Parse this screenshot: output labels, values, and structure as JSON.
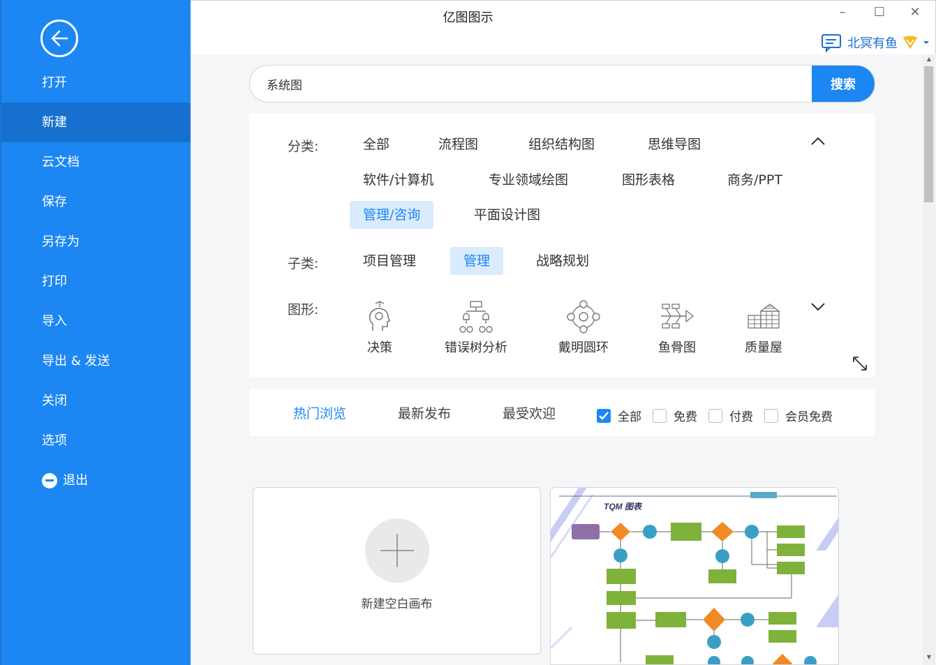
{
  "app": {
    "title": "亿图图示"
  },
  "user": {
    "name": "北冥有鱼"
  },
  "window": {
    "minimize": "–",
    "maximize": "☐",
    "close": "✕"
  },
  "sidebar": {
    "items": [
      {
        "label": "打开"
      },
      {
        "label": "新建",
        "active": true
      },
      {
        "label": "云文档"
      },
      {
        "label": "保存"
      },
      {
        "label": "另存为"
      },
      {
        "label": "打印"
      },
      {
        "label": "导入"
      },
      {
        "label": "导出 & 发送"
      },
      {
        "label": "关闭"
      },
      {
        "label": "选项"
      },
      {
        "label": "退出",
        "icon": "minus-circle-icon"
      }
    ]
  },
  "search": {
    "value": "系统图",
    "button": "搜索"
  },
  "filters": {
    "category_label": "分类:",
    "categories": [
      "全部",
      "流程图",
      "组织结构图",
      "思维导图",
      "软件/计算机",
      "专业领域绘图",
      "图形表格",
      "商务/PPT",
      "管理/咨询",
      "平面设计图"
    ],
    "category_selected": "管理/咨询",
    "subcategory_label": "子类:",
    "subcategories": [
      "项目管理",
      "管理",
      "战略规划"
    ],
    "subcategory_selected": "管理",
    "shape_label": "图形:",
    "shapes": [
      {
        "label": "决策",
        "icon": "head-decision-icon"
      },
      {
        "label": "错误树分析",
        "icon": "fault-tree-icon"
      },
      {
        "label": "戴明圆环",
        "icon": "deming-cycle-icon"
      },
      {
        "label": "鱼骨图",
        "icon": "fishbone-icon"
      },
      {
        "label": "质量屋",
        "icon": "house-of-quality-icon"
      }
    ]
  },
  "sort": {
    "tabs": [
      "热门浏览",
      "最新发布",
      "最受欢迎"
    ],
    "selected": "热门浏览",
    "price_filters": [
      {
        "label": "全部",
        "checked": true
      },
      {
        "label": "免费",
        "checked": false
      },
      {
        "label": "付费",
        "checked": false
      },
      {
        "label": "会员免费",
        "checked": false
      }
    ]
  },
  "cards": {
    "new_blank": "新建空白画布",
    "template_title": "TQM 图表"
  },
  "colors": {
    "brand": "#1c87f2",
    "sidebar_active": "#1770d0",
    "chip_selected_bg": "#d9ebfd",
    "vip": "#f5b820"
  }
}
